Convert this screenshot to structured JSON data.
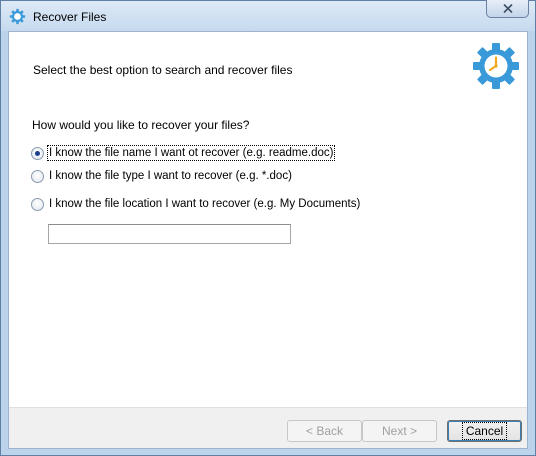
{
  "window": {
    "title": "Recover Files",
    "title_icon": "gear-icon",
    "close_icon": "close-icon"
  },
  "header": {
    "instruction": "Select the best option to search and recover files",
    "logo_icon": "gear-clock-icon",
    "logo_color": "#3a9ad9",
    "logo_hand_color": "#f0a81c"
  },
  "main": {
    "question": "How would you like to recover your files?",
    "options": [
      {
        "label": "I know the file name I want ot recover (e.g. readme.doc)",
        "checked": true
      },
      {
        "label": "I know the file type I want to recover (e.g. *.doc)",
        "checked": false
      },
      {
        "label": "I know the file location I want to recover (e.g. My Documents)",
        "checked": false
      }
    ],
    "location_value": ""
  },
  "footer": {
    "back_label": "< Back",
    "next_label": "Next >",
    "cancel_label": "Cancel",
    "back_enabled": false,
    "next_enabled": false
  }
}
